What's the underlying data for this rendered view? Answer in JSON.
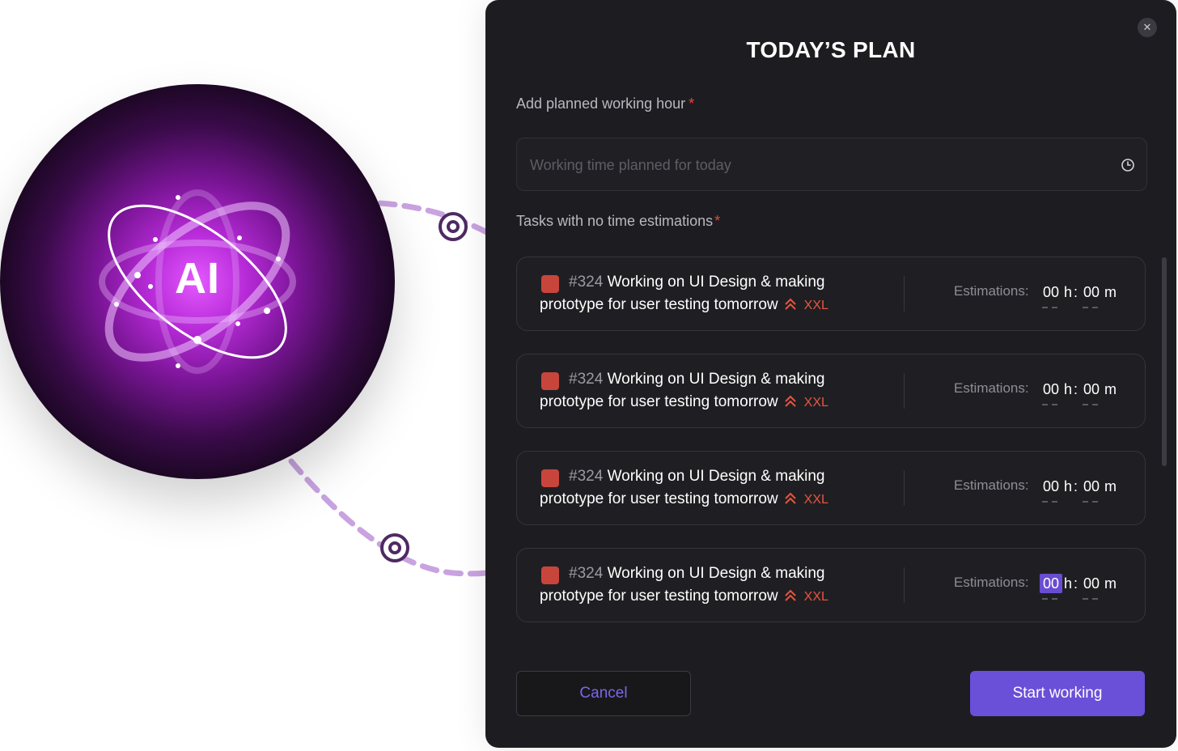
{
  "illustration": {
    "label": "AI"
  },
  "modal": {
    "title": "TODAY’S PLAN",
    "close_icon": "close-icon"
  },
  "working_hours": {
    "label": "Add planned working hour",
    "required_mark": "*",
    "placeholder": "Working time planned for today",
    "icon": "clock-icon"
  },
  "tasks_section": {
    "label": "Tasks with no time estimations",
    "required_mark": "*"
  },
  "tasks": [
    {
      "id": "#324",
      "title_line1": "Working on UI Design & making",
      "title_line2": "prototype for user testing tomorrow",
      "size": "XXL",
      "estimation_label": "Estimations:",
      "hours": "00",
      "hours_unit": "h",
      "separator": ":",
      "minutes": "00",
      "minutes_unit": "m"
    },
    {
      "id": "#324",
      "title_line1": "Working on UI Design & making",
      "title_line2": "prototype for user testing tomorrow",
      "size": "XXL",
      "estimation_label": "Estimations:",
      "hours": "00",
      "hours_unit": "h",
      "separator": ":",
      "minutes": "00",
      "minutes_unit": "m"
    },
    {
      "id": "#324",
      "title_line1": "Working on UI Design & making",
      "title_line2": "prototype for user testing tomorrow",
      "size": "XXL",
      "estimation_label": "Estimations:",
      "hours": "00",
      "hours_unit": "h",
      "separator": ":",
      "minutes": "00",
      "minutes_unit": "m"
    },
    {
      "id": "#324",
      "title_line1": "Working on UI Design & making",
      "title_line2": "prototype for user testing tomorrow",
      "size": "XXL",
      "estimation_label": "Estimations:",
      "hours": "00",
      "hours_unit": "h",
      "separator": ":",
      "minutes": "00",
      "minutes_unit": "m"
    }
  ],
  "footer": {
    "cancel_label": "Cancel",
    "start_label": "Start working"
  },
  "colors": {
    "accent": "#6a4fd8",
    "danger": "#e8553f",
    "bug": "#c8453b",
    "orb_glow": "#d64cf5"
  }
}
